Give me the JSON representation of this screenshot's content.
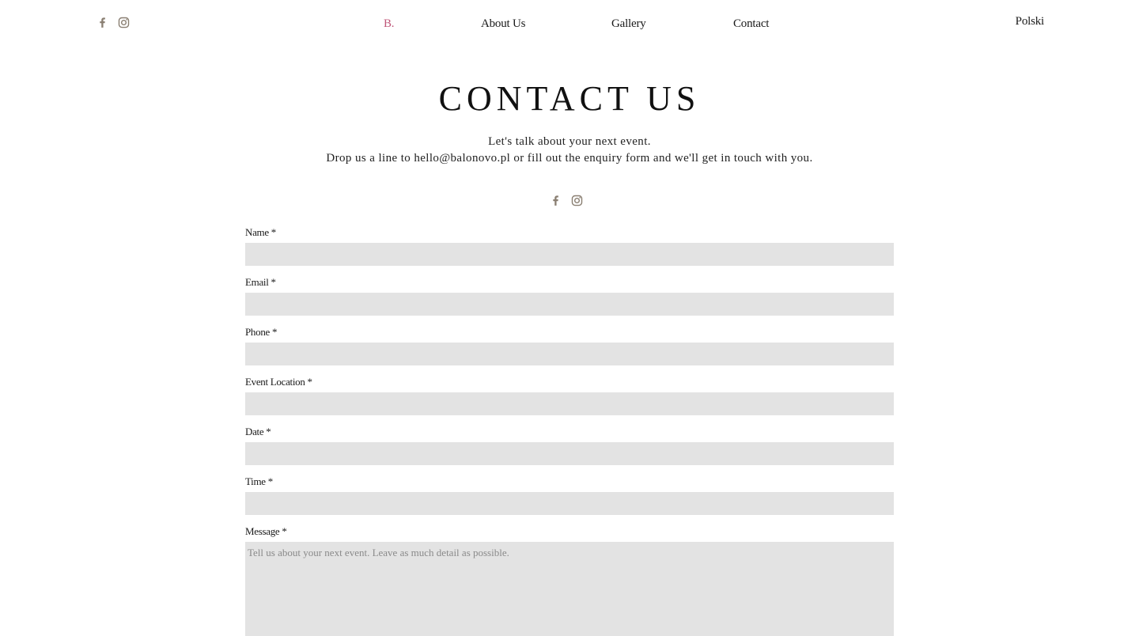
{
  "header": {
    "social": [
      {
        "name": "facebook-icon"
      },
      {
        "name": "instagram-icon"
      }
    ],
    "nav": {
      "home": "B.",
      "about": "About Us",
      "gallery": "Gallery",
      "contact": "Contact"
    },
    "language": "Polski"
  },
  "colors": {
    "accent": "#c0587a",
    "icon": "#8a7f72",
    "field_bg": "#e3e3e3"
  },
  "main": {
    "title": "CONTACT US",
    "intro_line1": "Let's talk about your next event.",
    "intro_line2": "Drop us a line to hello@balonovo.pl or fill out the enquiry form and we'll get in touch with you."
  },
  "form": {
    "name_label": "Name *",
    "email_label": "Email *",
    "phone_label": "Phone *",
    "location_label": "Event Location *",
    "date_label": "Date *",
    "time_label": "Time *",
    "message_label": "Message *",
    "message_placeholder": "Tell us about your next event. Leave as much detail as possible."
  }
}
